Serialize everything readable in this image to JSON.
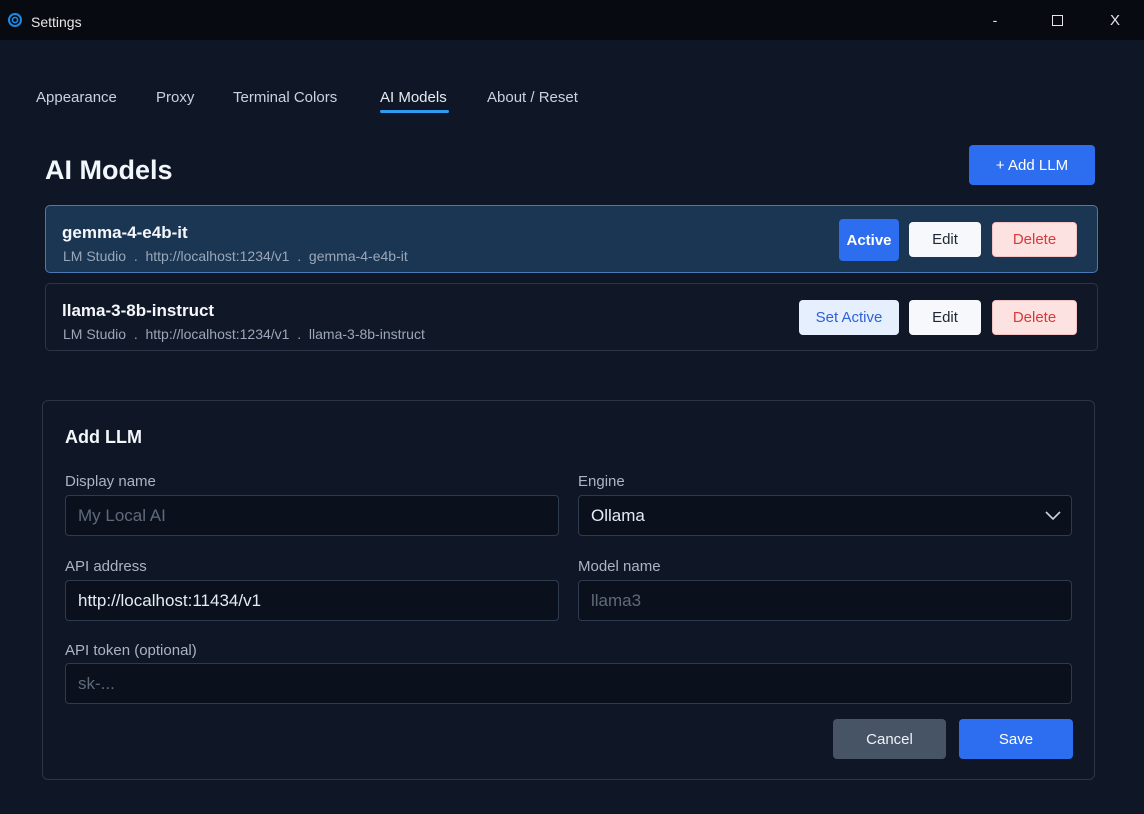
{
  "window": {
    "title": "Settings",
    "minimize": "-",
    "close": "X"
  },
  "tabs": [
    {
      "label": "Appearance"
    },
    {
      "label": "Proxy"
    },
    {
      "label": "Terminal Colors"
    },
    {
      "label": "AI Models",
      "active": true
    },
    {
      "label": "About / Reset"
    }
  ],
  "page": {
    "title": "AI Models",
    "add_button": "+ Add LLM"
  },
  "models": [
    {
      "name": "gemma-4-e4b-it",
      "meta": "LM Studio  .  http://localhost:1234/v1  .  gemma-4-e4b-it",
      "status": "Active",
      "edit": "Edit",
      "delete": "Delete"
    },
    {
      "name": "llama-3-8b-instruct",
      "meta": "LM Studio  .  http://localhost:1234/v1  .  llama-3-8b-instruct",
      "status": "Set Active",
      "edit": "Edit",
      "delete": "Delete"
    }
  ],
  "form": {
    "title": "Add LLM",
    "display_name": {
      "label": "Display name",
      "value": "",
      "placeholder": "My Local AI"
    },
    "engine": {
      "label": "Engine",
      "value": "Ollama"
    },
    "api_address": {
      "label": "API address",
      "value": "http://localhost:11434/v1",
      "placeholder": ""
    },
    "model_name": {
      "label": "Model name",
      "value": "",
      "placeholder": "llama3"
    },
    "api_token": {
      "label": "API token (optional)",
      "value": "",
      "placeholder": "sk-..."
    },
    "cancel": "Cancel",
    "save": "Save"
  },
  "colors": {
    "accent": "#2d6df0",
    "tab_underline": "#2f9bf0",
    "danger": "#d63a3a",
    "background": "#0f1726"
  }
}
